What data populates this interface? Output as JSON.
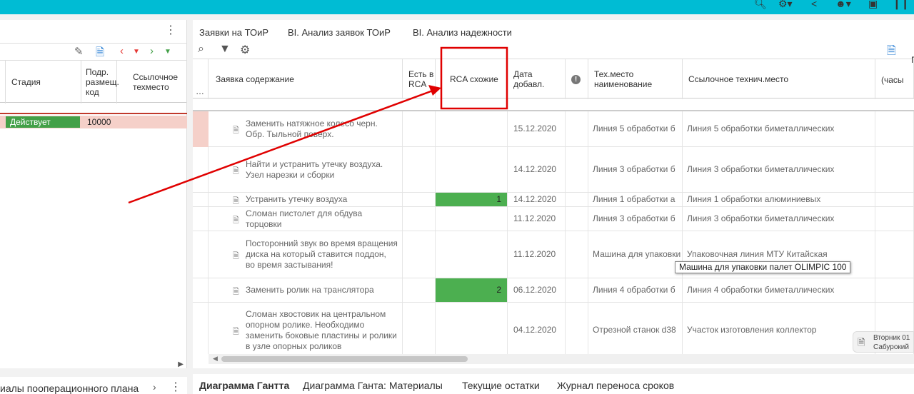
{
  "topbar": {
    "icons": [
      "search-icon",
      "gear-icon",
      "share-icon",
      "users-icon",
      "save-icon",
      "pause-icon"
    ]
  },
  "left_panel": {
    "columns": {
      "stage": "Стадия",
      "dept_code": "Подр. размещ. код",
      "ref_place": "Ссылочное техместо"
    },
    "row": {
      "stage": "Действует",
      "code": "10000"
    },
    "colors": {
      "stage_badge": "#43a047",
      "row_highlight": "#f5d0c9"
    }
  },
  "bottom_left": {
    "title": "иалы пооперационного плана"
  },
  "tabs": [
    "Заявки на ТОиР",
    "BI. Анализ заявок ТОиР",
    "BI. Анализ надежности"
  ],
  "table": {
    "headers": {
      "content": "Заявка содержание",
      "has_rca": "Есть в RCA",
      "rca_similar": "RCA схожие",
      "date_added": "Дата добавл.",
      "place_name": "Тех.место наименование",
      "ref_place": "Ссылочное технич.место",
      "extra_top": "Пр",
      "extra_bottom": "(часы"
    },
    "rows": [
      {
        "content": "Заменить натяжное колесо черн. Обр. Тыльной поверх.",
        "rca": "",
        "date": "15.12.2020",
        "place": "Линия 5 обработки б",
        "ref": "Линия 5 обработки биметаллических"
      },
      {
        "content": "Найти и устранить утечку воздуха. Узел нарезки и сборки",
        "rca": "",
        "date": "14.12.2020",
        "place": "Линия 3 обработки б",
        "ref": "Линия 3 обработки биметаллических"
      },
      {
        "content": "Устранить утечку воздуха",
        "rca": "1",
        "date": "14.12.2020",
        "place": "Линия 1 обработки а",
        "ref": "Линия 1 обработки алюминиевых"
      },
      {
        "content": "Сломан пистолет для обдува торцовки",
        "rca": "",
        "date": "11.12.2020",
        "place": "Линия 3 обработки б",
        "ref": "Линия 3 обработки биметаллических"
      },
      {
        "content": "Посторонний звук во время вращения диска на который ставится поддон, во время застывания!",
        "rca": "",
        "date": "11.12.2020",
        "place": "Машина для упаковки",
        "ref": "Упаковочная линия МТУ Китайская"
      },
      {
        "content": "Заменить ролик на транслятора",
        "rca": "2",
        "date": "06.12.2020",
        "place": "Линия 4 обработки б",
        "ref": "Линия 4 обработки биметаллических"
      },
      {
        "content": "Сломан хвостовик на центральном опорном ролике. Необходимо заменить боковые пластины и ролики в узле опорных роликов",
        "rca": "",
        "date": "04.12.2020",
        "place": "Отрезной станок d38",
        "ref": "Участок изготовления коллектор"
      }
    ],
    "colors": {
      "rca_green": "#4caf50",
      "annotation_red": "#e00000"
    }
  },
  "tooltip": "Машина для упаковки палет OLIMPIC 100",
  "notification": {
    "line1": "Вторник 01",
    "line2": "Сабурокий"
  },
  "bottom_tabs": [
    "Диаграмма Гантта",
    "Диаграмма Ганта: Материалы",
    "Текущие остатки",
    "Журнал переноса сроков"
  ]
}
